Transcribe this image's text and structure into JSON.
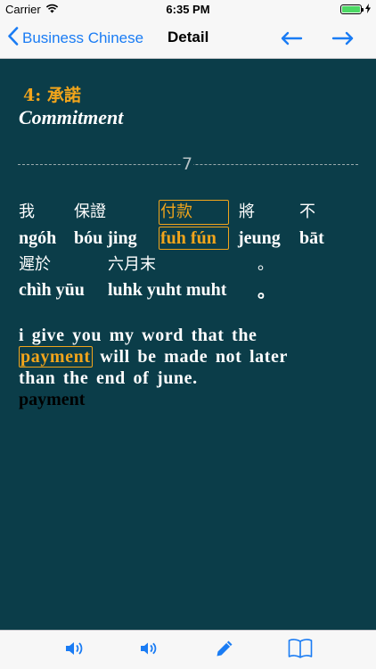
{
  "status_bar": {
    "carrier": "Carrier",
    "time": "6:35 PM",
    "battery_level": 1.0,
    "icons": [
      "wifi-icon",
      "battery-icon",
      "charging-icon"
    ]
  },
  "nav": {
    "back_label": "Business Chinese",
    "title": "Detail",
    "icons": [
      "chevron-left-icon",
      "arrow-left-icon",
      "arrow-right-icon"
    ]
  },
  "lesson": {
    "title": "4: 承諾",
    "subtitle": "Commitment",
    "sentence_number": "7"
  },
  "sentence": {
    "line1": [
      {
        "char": "我",
        "pinyin": "ngóh",
        "highlight": false
      },
      {
        "char": "保證",
        "pinyin": "bóu jing",
        "highlight": false
      },
      {
        "char": "付款",
        "pinyin": "fuh fún",
        "highlight": true
      },
      {
        "char": "將",
        "pinyin": "jeung",
        "highlight": false
      },
      {
        "char": "不",
        "pinyin": "bāt",
        "highlight": false
      }
    ],
    "line2": [
      {
        "char": "遲於",
        "pinyin": "chìh yūu",
        "highlight": false
      },
      {
        "char": "六月末",
        "pinyin": "luhk yuht muht",
        "highlight": false
      },
      {
        "char": "。",
        "pinyin": "。",
        "highlight": false
      }
    ]
  },
  "translation": {
    "line1": "i give you my word that the",
    "highlight_word": "payment",
    "line2_rest": "will be made not later",
    "line3": "than the end of june.",
    "footer_word": "payment"
  },
  "colors": {
    "background": "#0b3d49",
    "highlight": "#f2a51b",
    "accent": "#1a7cf4"
  },
  "toolbar": {
    "icons": [
      "speaker-icon",
      "speaker-slow-icon",
      "pencil-icon",
      "book-icon"
    ]
  }
}
